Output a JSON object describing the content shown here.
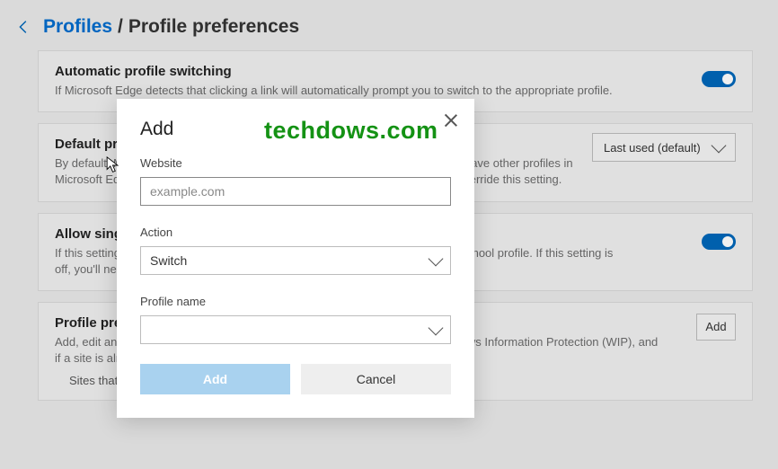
{
  "header": {
    "crumb_root": "Profiles",
    "crumb_sep": "/",
    "crumb_current": "Profile preferences"
  },
  "cards": {
    "auto_switch": {
      "title": "Automatic profile switching",
      "desc": "If Microsoft Edge detects that clicking a link will automatically prompt you to switch to the appropriate profile."
    },
    "default_profile": {
      "title": "Default profile for external links",
      "desc": "By default, Microsoft Edge opens external links with the last used profile. If you have other profiles in Microsoft Edge, specific site-to-profile associations that are defined below will override this setting.",
      "dropdown": "Last used (default)"
    },
    "single_signon": {
      "title": "Allow single sign-on for work or school sites using this profile",
      "desc": "If this setting is on, signing in to this profile will also sign you in to your work or school profile. If this setting is off, you'll need to switch to your work or school profile."
    },
    "profile_prefs": {
      "title": "Profile preferences for sites",
      "desc": "Add, edit and delete site-to-profile associations. If your organization uses Windows Information Protection (WIP), and if a site is already protected, it will override these profile preference settings.",
      "add_btn": "Add",
      "inset_line": "Sites that you add will appear here"
    }
  },
  "modal": {
    "title": "Add",
    "website_label": "Website",
    "website_placeholder": "example.com",
    "website_value": "",
    "action_label": "Action",
    "action_value": "Switch",
    "profile_label": "Profile name",
    "profile_value": "",
    "add_btn": "Add",
    "cancel_btn": "Cancel"
  },
  "watermark": "techdows.com"
}
